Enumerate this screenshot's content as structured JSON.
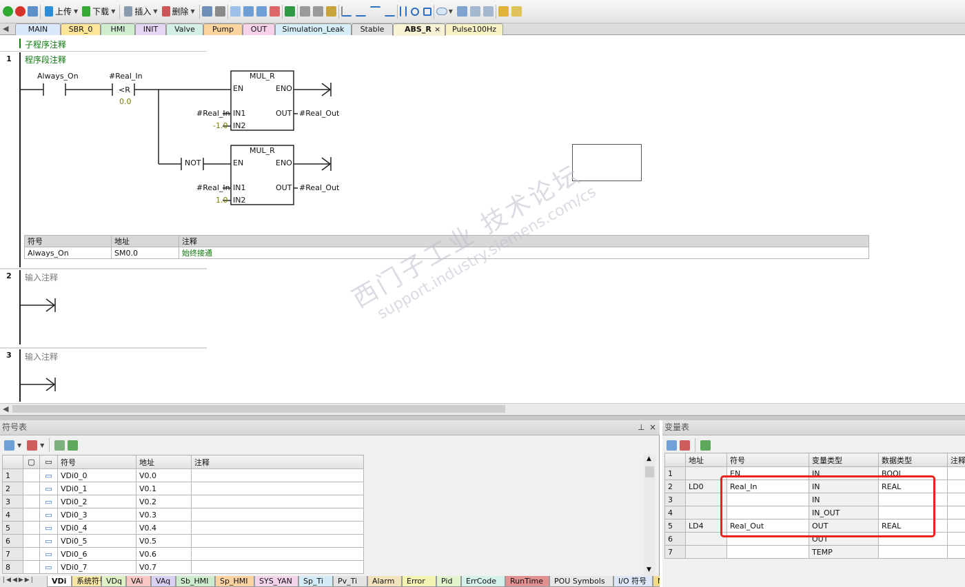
{
  "toolbar": {
    "upload_label": "上传",
    "download_label": "下载",
    "insert_label": "插入",
    "delete_label": "删除"
  },
  "tabs": [
    {
      "label": "MAIN",
      "color": "#d9e8fb"
    },
    {
      "label": "SBR_0",
      "color": "#fde59a"
    },
    {
      "label": "HMI",
      "color": "#cfeecf"
    },
    {
      "label": "INIT",
      "color": "#e5d6f5"
    },
    {
      "label": "Valve",
      "color": "#d4efe3"
    },
    {
      "label": "Pump",
      "color": "#fbd4a0"
    },
    {
      "label": "OUT",
      "color": "#f7d3ea"
    },
    {
      "label": "Simulation_Leak",
      "color": "#d6eef8"
    },
    {
      "label": "Stable",
      "color": "#e3e3e3"
    },
    {
      "label": "ABS_R",
      "color": "#f9f3d6",
      "active": true
    },
    {
      "label": "Pulse100Hz",
      "color": "#f7f2c5"
    }
  ],
  "tab_close": "×",
  "editor": {
    "sub_comment": "子程序注释",
    "networks": [
      {
        "number": "1",
        "comment": "程序段注释"
      },
      {
        "number": "2",
        "comment": "输入注释"
      },
      {
        "number": "3",
        "comment": "输入注释"
      }
    ],
    "contact_always_on": "Always_On",
    "compare_operand": "#Real_In",
    "compare_op": "<R",
    "compare_value": "0.0",
    "not_label": "NOT",
    "block1": {
      "title": "MUL_R",
      "en": "EN",
      "eno": "ENO",
      "in1": "IN1",
      "in2": "IN2",
      "out": "OUT",
      "in1_val": "#Real_In",
      "in2_val": "-1.0",
      "out_val": "#Real_Out"
    },
    "block2": {
      "title": "MUL_R",
      "en": "EN",
      "eno": "ENO",
      "in1": "IN1",
      "in2": "IN2",
      "out": "OUT",
      "in1_val": "#Real_In",
      "in2_val": "1.0",
      "out_val": "#Real_Out"
    },
    "symbol_info": {
      "headers": [
        "符号",
        "地址",
        "注释"
      ],
      "row": [
        "Always_On",
        "SM0.0",
        "始终接通"
      ]
    },
    "watermark_line1": "西门子工业  技术论坛",
    "watermark_line2": "support.industry.siemens.com/cs"
  },
  "symbol_table": {
    "title": "符号表",
    "pin": "ᵖ",
    "close": "×",
    "headers": [
      "符号",
      "地址",
      "注释"
    ],
    "rows": [
      {
        "num": "1",
        "symbol": "VDi0_0",
        "addr": "V0.0"
      },
      {
        "num": "2",
        "symbol": "VDi0_1",
        "addr": "V0.1"
      },
      {
        "num": "3",
        "symbol": "VDi0_2",
        "addr": "V0.2"
      },
      {
        "num": "4",
        "symbol": "VDi0_3",
        "addr": "V0.3"
      },
      {
        "num": "5",
        "symbol": "VDi0_4",
        "addr": "V0.4"
      },
      {
        "num": "6",
        "symbol": "VDi0_5",
        "addr": "V0.5"
      },
      {
        "num": "7",
        "symbol": "VDi0_6",
        "addr": "V0.6"
      },
      {
        "num": "8",
        "symbol": "VDi0_7",
        "addr": "V0.7"
      }
    ],
    "bottom_tabs": [
      {
        "label": "VDi",
        "color": "#ffffff",
        "bold": true
      },
      {
        "label": "系统符号",
        "color": "#f7e7a6"
      },
      {
        "label": "VDq",
        "color": "#dff0c4"
      },
      {
        "label": "VAi",
        "color": "#f9c6c6"
      },
      {
        "label": "VAq",
        "color": "#d9d0f3"
      },
      {
        "label": "Sb_HMI",
        "color": "#cdeccd"
      },
      {
        "label": "Sp_HMI",
        "color": "#fbd3a2"
      },
      {
        "label": "SYS_YAN",
        "color": "#f3d3ec"
      },
      {
        "label": "Sp_Ti",
        "color": "#d3ecf7"
      },
      {
        "label": "Pv_Ti",
        "color": "#e3e3e3"
      },
      {
        "label": "Alarm",
        "color": "#f3e3bc"
      },
      {
        "label": "Error",
        "color": "#f3f3b4"
      },
      {
        "label": "Pid",
        "color": "#e2f3cd"
      },
      {
        "label": "ErrCode",
        "color": "#d3f0ea"
      },
      {
        "label": "RunTime",
        "color": "#e39090"
      },
      {
        "label": "POU Symbols",
        "color": "#e7e7e7"
      },
      {
        "label": "I/O 符号",
        "color": "#dde7f7"
      },
      {
        "label": "Modbus TC",
        "color": "#f3d990"
      }
    ]
  },
  "var_table": {
    "title": "变量表",
    "headers": [
      "地址",
      "符号",
      "变量类型",
      "数据类型",
      "注释"
    ],
    "rows": [
      {
        "num": "1",
        "addr": "",
        "symbol": "EN",
        "vtype": "IN",
        "dtype": "BOOL"
      },
      {
        "num": "2",
        "addr": "LD0",
        "symbol": "Real_In",
        "vtype": "IN",
        "dtype": "REAL"
      },
      {
        "num": "3",
        "addr": "",
        "symbol": "",
        "vtype": "IN",
        "dtype": ""
      },
      {
        "num": "4",
        "addr": "",
        "symbol": "",
        "vtype": "IN_OUT",
        "dtype": ""
      },
      {
        "num": "5",
        "addr": "LD4",
        "symbol": "Real_Out",
        "vtype": "OUT",
        "dtype": "REAL"
      },
      {
        "num": "6",
        "addr": "",
        "symbol": "",
        "vtype": "OUT",
        "dtype": ""
      },
      {
        "num": "7",
        "addr": "",
        "symbol": "",
        "vtype": "TEMP",
        "dtype": ""
      }
    ]
  },
  "colors": {
    "comment_green": "#0a7a0a",
    "value_olive": "#7a7a00",
    "highlight_red": "#e8231b"
  }
}
